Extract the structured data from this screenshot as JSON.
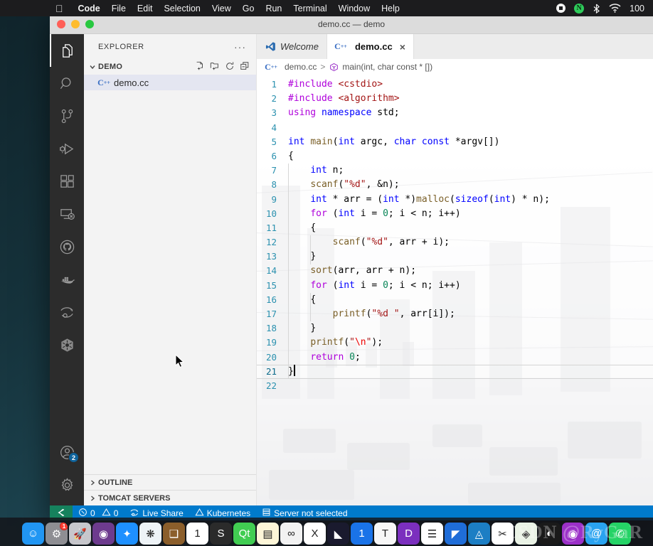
{
  "menubar": {
    "apple_icon": "apple-logo-icon",
    "items": [
      "Code",
      "File",
      "Edit",
      "Selection",
      "View",
      "Go",
      "Run",
      "Terminal",
      "Window",
      "Help"
    ],
    "status_icons": [
      "record-stop-icon",
      "nord-vpn-icon",
      "bluetooth-icon",
      "wifi-icon"
    ],
    "battery_percent": "100"
  },
  "window": {
    "title": "demo.cc — demo"
  },
  "activitybar": {
    "items": [
      {
        "name": "explorer",
        "icon": "files-icon",
        "active": true
      },
      {
        "name": "search",
        "icon": "search-icon",
        "active": false
      },
      {
        "name": "source-control",
        "icon": "source-control-icon",
        "active": false
      },
      {
        "name": "run-and-debug",
        "icon": "run-debug-icon",
        "active": false
      },
      {
        "name": "extensions",
        "icon": "extensions-icon",
        "active": false
      },
      {
        "name": "remote-explorer",
        "icon": "remote-explorer-icon",
        "active": false
      },
      {
        "name": "github",
        "icon": "github-icon",
        "active": false
      },
      {
        "name": "docker",
        "icon": "docker-icon",
        "active": false
      },
      {
        "name": "live-share",
        "icon": "live-share-icon",
        "active": false
      },
      {
        "name": "kubernetes",
        "icon": "kubernetes-icon",
        "active": false
      }
    ],
    "account": {
      "icon": "account-icon",
      "badge": "2"
    },
    "settings": {
      "icon": "gear-icon"
    }
  },
  "sidebar": {
    "title": "EXPLORER",
    "more_actions": "···",
    "folder": {
      "name": "DEMO",
      "expanded": true,
      "actions": [
        "new-file-icon",
        "new-folder-icon",
        "refresh-icon",
        "collapse-all-icon"
      ]
    },
    "files": [
      {
        "name": "demo.cc",
        "icon": "cpp-file-icon",
        "selected": true
      }
    ],
    "collapsed_sections": [
      "OUTLINE",
      "TOMCAT SERVERS"
    ]
  },
  "tabs": [
    {
      "label": "Welcome",
      "icon": "vscode-logo-icon",
      "active": false,
      "preview": true,
      "closable": false
    },
    {
      "label": "demo.cc",
      "icon": "cpp-file-icon",
      "active": true,
      "preview": false,
      "closable": true,
      "close_glyph": "×"
    }
  ],
  "breadcrumb": {
    "file_icon": "cpp-file-icon",
    "file": "demo.cc",
    "separator": ">",
    "symbol_icon": "method-symbol-icon",
    "symbol": "main(int, char const * [])"
  },
  "editor": {
    "language": "cpp",
    "current_line": 21,
    "cursor_column": 2,
    "lines": [
      {
        "n": 1,
        "indent": 0,
        "tokens": [
          {
            "t": "#include ",
            "c": "pp"
          },
          {
            "t": "<cstdio>",
            "c": "inc"
          }
        ]
      },
      {
        "n": 2,
        "indent": 0,
        "tokens": [
          {
            "t": "#include ",
            "c": "pp"
          },
          {
            "t": "<algorithm>",
            "c": "inc"
          }
        ]
      },
      {
        "n": 3,
        "indent": 0,
        "tokens": [
          {
            "t": "using ",
            "c": "ctl"
          },
          {
            "t": "namespace ",
            "c": "kw"
          },
          {
            "t": "std;",
            "c": "plain"
          }
        ]
      },
      {
        "n": 4,
        "indent": 0,
        "tokens": []
      },
      {
        "n": 5,
        "indent": 0,
        "tokens": [
          {
            "t": "int ",
            "c": "kw"
          },
          {
            "t": "main",
            "c": "fn"
          },
          {
            "t": "(",
            "c": "plain"
          },
          {
            "t": "int",
            "c": "kw"
          },
          {
            "t": " argc, ",
            "c": "plain"
          },
          {
            "t": "char",
            "c": "kw"
          },
          {
            "t": " ",
            "c": "plain"
          },
          {
            "t": "const",
            "c": "kw"
          },
          {
            "t": " *argv[])",
            "c": "plain"
          }
        ]
      },
      {
        "n": 6,
        "indent": 0,
        "tokens": [
          {
            "t": "{",
            "c": "plain"
          }
        ]
      },
      {
        "n": 7,
        "indent": 1,
        "tokens": [
          {
            "t": "int",
            "c": "kw"
          },
          {
            "t": " n;",
            "c": "plain"
          }
        ]
      },
      {
        "n": 8,
        "indent": 1,
        "tokens": [
          {
            "t": "scanf",
            "c": "fn"
          },
          {
            "t": "(",
            "c": "plain"
          },
          {
            "t": "\"%d\"",
            "c": "str"
          },
          {
            "t": ", &n);",
            "c": "plain"
          }
        ]
      },
      {
        "n": 9,
        "indent": 1,
        "tokens": [
          {
            "t": "int",
            "c": "kw"
          },
          {
            "t": " * arr = (",
            "c": "plain"
          },
          {
            "t": "int",
            "c": "kw"
          },
          {
            "t": " *)",
            "c": "plain"
          },
          {
            "t": "malloc",
            "c": "fn"
          },
          {
            "t": "(",
            "c": "plain"
          },
          {
            "t": "sizeof",
            "c": "kw"
          },
          {
            "t": "(",
            "c": "plain"
          },
          {
            "t": "int",
            "c": "kw"
          },
          {
            "t": ") * n);",
            "c": "plain"
          }
        ]
      },
      {
        "n": 10,
        "indent": 1,
        "tokens": [
          {
            "t": "for",
            "c": "ctl"
          },
          {
            "t": " (",
            "c": "plain"
          },
          {
            "t": "int",
            "c": "kw"
          },
          {
            "t": " i = ",
            "c": "plain"
          },
          {
            "t": "0",
            "c": "num"
          },
          {
            "t": "; i < n; i++)",
            "c": "plain"
          }
        ]
      },
      {
        "n": 11,
        "indent": 1,
        "tokens": [
          {
            "t": "{",
            "c": "plain"
          }
        ]
      },
      {
        "n": 12,
        "indent": 2,
        "tokens": [
          {
            "t": "scanf",
            "c": "fn"
          },
          {
            "t": "(",
            "c": "plain"
          },
          {
            "t": "\"%d\"",
            "c": "str"
          },
          {
            "t": ", arr + i);",
            "c": "plain"
          }
        ]
      },
      {
        "n": 13,
        "indent": 1,
        "tokens": [
          {
            "t": "}",
            "c": "plain"
          }
        ]
      },
      {
        "n": 14,
        "indent": 1,
        "tokens": [
          {
            "t": "sort",
            "c": "fn"
          },
          {
            "t": "(arr, arr + n);",
            "c": "plain"
          }
        ]
      },
      {
        "n": 15,
        "indent": 1,
        "tokens": [
          {
            "t": "for",
            "c": "ctl"
          },
          {
            "t": " (",
            "c": "plain"
          },
          {
            "t": "int",
            "c": "kw"
          },
          {
            "t": " i = ",
            "c": "plain"
          },
          {
            "t": "0",
            "c": "num"
          },
          {
            "t": "; i < n; i++)",
            "c": "plain"
          }
        ]
      },
      {
        "n": 16,
        "indent": 1,
        "tokens": [
          {
            "t": "{",
            "c": "plain"
          }
        ]
      },
      {
        "n": 17,
        "indent": 2,
        "tokens": [
          {
            "t": "printf",
            "c": "fn"
          },
          {
            "t": "(",
            "c": "plain"
          },
          {
            "t": "\"%d \"",
            "c": "str"
          },
          {
            "t": ", arr[i]);",
            "c": "plain"
          }
        ]
      },
      {
        "n": 18,
        "indent": 1,
        "tokens": [
          {
            "t": "}",
            "c": "plain"
          }
        ]
      },
      {
        "n": 19,
        "indent": 1,
        "tokens": [
          {
            "t": "printf",
            "c": "fn"
          },
          {
            "t": "(",
            "c": "plain"
          },
          {
            "t": "\"",
            "c": "str"
          },
          {
            "t": "\\n",
            "c": "esc"
          },
          {
            "t": "\"",
            "c": "str"
          },
          {
            "t": ");",
            "c": "plain"
          }
        ]
      },
      {
        "n": 20,
        "indent": 1,
        "tokens": [
          {
            "t": "return",
            "c": "ctl"
          },
          {
            "t": " ",
            "c": "plain"
          },
          {
            "t": "0",
            "c": "num"
          },
          {
            "t": ";",
            "c": "plain"
          }
        ]
      },
      {
        "n": 21,
        "indent": 0,
        "tokens": [
          {
            "t": "}",
            "c": "plain"
          }
        ]
      },
      {
        "n": 22,
        "indent": 0,
        "tokens": []
      }
    ]
  },
  "statusbar": {
    "remote_icon": "remote-window-icon",
    "errors_icon": "error-icon",
    "errors": "0",
    "warnings_icon": "warning-icon",
    "warnings": "0",
    "live_share_icon": "live-share-icon",
    "live_share": "Live Share",
    "kubernetes_icon": "kubernetes-warning-icon",
    "kubernetes": "Kubernetes",
    "server_icon": "server-icon",
    "server": "Server not selected"
  },
  "dock": {
    "items": [
      {
        "name": "finder",
        "glyph": "☺",
        "bg": "#2196f3",
        "badge": null,
        "running": true
      },
      {
        "name": "system-preferences",
        "glyph": "⚙",
        "bg": "#8e8e93",
        "badge": "1",
        "running": false
      },
      {
        "name": "launchpad",
        "glyph": "🚀",
        "bg": "#c7c7cc",
        "badge": null,
        "running": false
      },
      {
        "name": "siri",
        "glyph": "◉",
        "bg": "#6d3b8e",
        "badge": null,
        "running": false
      },
      {
        "name": "safari",
        "glyph": "✦",
        "bg": "#1e90ff",
        "badge": null,
        "running": false
      },
      {
        "name": "photos",
        "glyph": "❋",
        "bg": "#eef3f7",
        "badge": null,
        "running": false
      },
      {
        "name": "contacts",
        "glyph": "❑",
        "bg": "#8b5e2b",
        "badge": null,
        "running": false
      },
      {
        "name": "calendar",
        "glyph": "1",
        "bg": "#ffffff",
        "badge": null,
        "running": false
      },
      {
        "name": "sublime-text",
        "glyph": "S",
        "bg": "#2b2b2b",
        "badge": null,
        "running": false
      },
      {
        "name": "qt-creator",
        "glyph": "Qt",
        "bg": "#41cd52",
        "badge": null,
        "running": false
      },
      {
        "name": "notes",
        "glyph": "▤",
        "bg": "#fdf6d8",
        "badge": null,
        "running": false
      },
      {
        "name": "eclipse",
        "glyph": "∞",
        "bg": "#f2f2f2",
        "badge": null,
        "running": false
      },
      {
        "name": "xmind",
        "glyph": "X",
        "bg": "#ffffff",
        "badge": null,
        "running": false
      },
      {
        "name": "jetbrains-toolbox",
        "glyph": "◣",
        "bg": "#1a1a2e",
        "badge": null,
        "running": false
      },
      {
        "name": "1password",
        "glyph": "1",
        "bg": "#1a73e8",
        "badge": null,
        "running": false
      },
      {
        "name": "typora",
        "glyph": "T",
        "bg": "#f7f7f7",
        "badge": null,
        "running": false
      },
      {
        "name": "dash",
        "glyph": "D",
        "bg": "#7b2fbe",
        "badge": null,
        "running": false
      },
      {
        "name": "reminders",
        "glyph": "☰",
        "bg": "#ffffff",
        "badge": null,
        "running": false
      },
      {
        "name": "wireshark",
        "glyph": "◤",
        "bg": "#1f6dd8",
        "badge": null,
        "running": false
      },
      {
        "name": "azure-data-studio",
        "glyph": "◬",
        "bg": "#1c7ec4",
        "badge": null,
        "running": false
      },
      {
        "name": "visual-studio-code",
        "glyph": "✂",
        "bg": "#ffffff",
        "badge": null,
        "running": true
      },
      {
        "name": "maps",
        "glyph": "◈",
        "bg": "#eaf3e6",
        "badge": null,
        "running": false
      },
      {
        "name": "firefox",
        "glyph": "◐",
        "bg": "#1a1a1a",
        "badge": null,
        "running": false
      },
      {
        "name": "podcasts",
        "glyph": "◉",
        "bg": "#9b30c8",
        "badge": null,
        "running": false
      },
      {
        "name": "mail",
        "glyph": "@",
        "bg": "#2aa3f0",
        "badge": null,
        "running": false
      },
      {
        "name": "whatsapp",
        "glyph": "✆",
        "bg": "#25d366",
        "badge": null,
        "running": true
      }
    ]
  },
  "watermark": "CSDN @RyGaR"
}
